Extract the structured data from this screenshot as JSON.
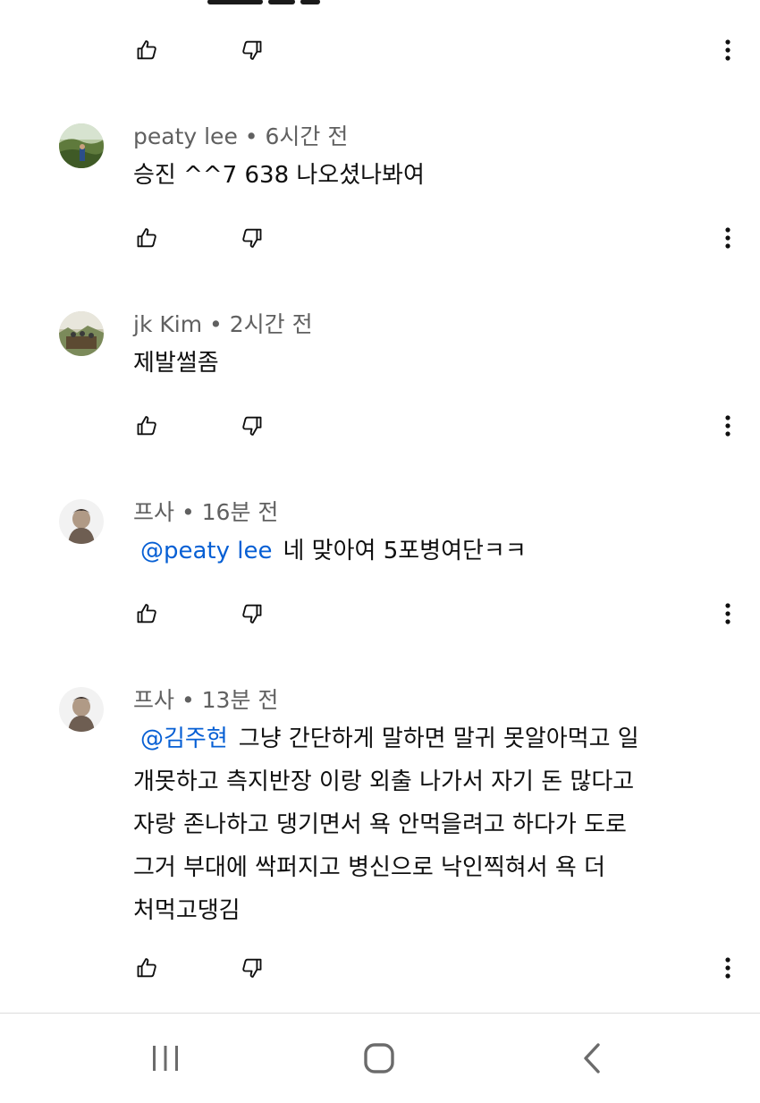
{
  "comments": [
    {
      "author": "peaty lee",
      "time": "6시간 전",
      "mention": "",
      "lines": [
        "승진 ^^7 638 나오셨나봐여"
      ]
    },
    {
      "author": "jk Kim",
      "time": "2시간 전",
      "mention": "",
      "lines": [
        "제발썰좀"
      ]
    },
    {
      "author": "프사",
      "time": "16분 전",
      "mention": "@peaty lee",
      "lines": [
        "네 맞아여 5포병여단ㅋㅋ"
      ]
    },
    {
      "author": "프사",
      "time": "13분 전",
      "mention": "@김주현",
      "lines": [
        "그냥 간단하게 말하면 말귀 못알아먹고 일",
        "개못하고 측지반장 이랑 외출 나가서 자기 돈 많다고",
        "자랑 존나하고 댕기면서 욕 안먹을려고 하다가 도로",
        "그거 부대에 싹퍼지고 병신으로 낙인찍혀서 욕 더",
        "처먹고댕김"
      ]
    }
  ],
  "separator": " • ",
  "icons": {
    "like": "thumbs-up-icon",
    "dislike": "thumbs-down-icon",
    "more": "more-vertical-icon",
    "nav_recent": "recent-apps-icon",
    "nav_home": "home-icon",
    "nav_back": "back-icon"
  },
  "colors": {
    "text": "#0f0f0f",
    "meta": "#606060",
    "mention": "#065fd4",
    "nav": "#6b6b6b"
  }
}
